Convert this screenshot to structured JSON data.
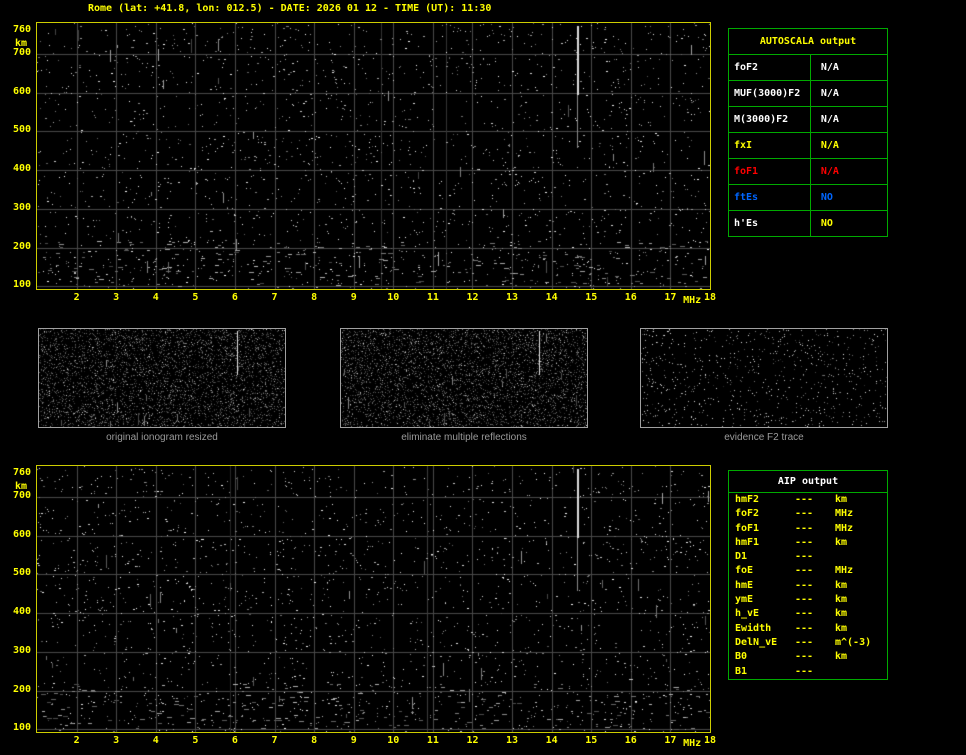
{
  "title": "Rome (lat: +41.8, lon: 012.5) - DATE: 2026 01 12 - TIME (UT): 11:30",
  "ionogram": {
    "y_unit": "km",
    "y_ticks": [
      "760",
      "700",
      "600",
      "500",
      "400",
      "300",
      "200",
      "100"
    ],
    "x_ticks": [
      "2",
      "3",
      "4",
      "5",
      "6",
      "7",
      "8",
      "9",
      "10",
      "11",
      "12",
      "13",
      "14",
      "15",
      "16",
      "17",
      "18"
    ],
    "x_unit": "MHz"
  },
  "autoscala": {
    "title": "AUTOSCALA output",
    "rows": [
      {
        "label": "foF2",
        "value": "N/A",
        "label_color": "#ffffff",
        "value_color": "#ffffff"
      },
      {
        "label": "MUF(3000)F2",
        "value": "N/A",
        "label_color": "#ffffff",
        "value_color": "#ffffff"
      },
      {
        "label": "M(3000)F2",
        "value": "N/A",
        "label_color": "#ffffff",
        "value_color": "#ffffff"
      },
      {
        "label": "fxI",
        "value": "N/A",
        "label_color": "#ffff00",
        "value_color": "#ffff00"
      },
      {
        "label": "foF1",
        "value": "N/A",
        "label_color": "#ff0000",
        "value_color": "#ff0000"
      },
      {
        "label": "ftEs",
        "value": "NO",
        "label_color": "#0066ff",
        "value_color": "#0066ff"
      },
      {
        "label": "h'Es",
        "value": "NO",
        "label_color": "#ffffff",
        "value_color": "#ffff00"
      }
    ]
  },
  "thumbnails": [
    {
      "caption": "original ionogram resized"
    },
    {
      "caption": "eliminate multiple reflections"
    },
    {
      "caption": "evidence F2 trace"
    }
  ],
  "aip": {
    "title": "AIP output",
    "rows": [
      {
        "label": "hmF2",
        "value": "---",
        "unit": "km"
      },
      {
        "label": "foF2",
        "value": "---",
        "unit": "MHz"
      },
      {
        "label": "foF1",
        "value": "---",
        "unit": "MHz"
      },
      {
        "label": "hmF1",
        "value": "---",
        "unit": "km"
      },
      {
        "label": "D1",
        "value": "---",
        "unit": ""
      },
      {
        "label": "foE",
        "value": "---",
        "unit": "MHz"
      },
      {
        "label": "hmE",
        "value": "---",
        "unit": "km"
      },
      {
        "label": "ymE",
        "value": "---",
        "unit": "km"
      },
      {
        "label": "h_vE",
        "value": "---",
        "unit": "km"
      },
      {
        "label": "Ewidth",
        "value": "---",
        "unit": "km"
      },
      {
        "label": "DelN_vE",
        "value": "---",
        "unit": "m^(-3)"
      },
      {
        "label": "B0",
        "value": "---",
        "unit": "km"
      },
      {
        "label": "B1",
        "value": "---",
        "unit": ""
      }
    ]
  },
  "colors": {
    "accent_yellow": "#ffff00",
    "table_green": "#00aa00",
    "status_red": "#ff0000",
    "status_blue": "#0066ff",
    "caption_gray": "#9a9a9a"
  }
}
